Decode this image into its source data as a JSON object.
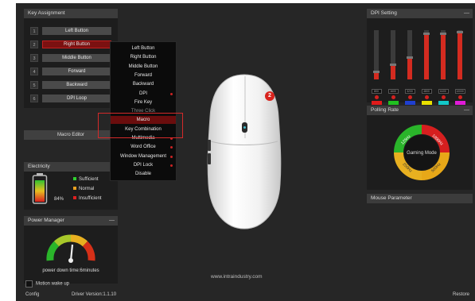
{
  "key_assignment": {
    "title": "Key Assignment",
    "rows": [
      {
        "num": "1",
        "label": "Left Button",
        "selected": false
      },
      {
        "num": "2",
        "label": "Right Button",
        "selected": true
      },
      {
        "num": "3",
        "label": "Middle Button",
        "selected": false
      },
      {
        "num": "4",
        "label": "Forward",
        "selected": false
      },
      {
        "num": "5",
        "label": "Backward",
        "selected": false
      },
      {
        "num": "6",
        "label": "DPI Loop",
        "selected": false
      }
    ],
    "macro_editor": "Macro Editor"
  },
  "context_menu": {
    "items": [
      {
        "label": "Left Button",
        "submenu": false
      },
      {
        "label": "Right Button",
        "submenu": false
      },
      {
        "label": "Middle Button",
        "submenu": false
      },
      {
        "label": "Forward",
        "submenu": false
      },
      {
        "label": "Backward",
        "submenu": false
      },
      {
        "label": "DPI",
        "submenu": true
      },
      {
        "label": "Fire Key",
        "submenu": false
      },
      {
        "label": "Three Click",
        "submenu": false,
        "dim": true
      },
      {
        "label": "Macro",
        "submenu": false,
        "highlight": true
      },
      {
        "label": "Key Combination",
        "submenu": false
      },
      {
        "label": "Multimedia",
        "submenu": true
      },
      {
        "label": "Word Office",
        "submenu": true
      },
      {
        "label": "Window Management",
        "submenu": true
      },
      {
        "label": "DPI Lock",
        "submenu": true
      },
      {
        "label": "Disable",
        "submenu": false
      }
    ]
  },
  "electricity": {
    "title": "Electricity",
    "percent_text": "84%",
    "level": 0.84,
    "legend": [
      {
        "label": "Sufficient",
        "color": "#2fd12f"
      },
      {
        "label": "Normal",
        "color": "#e8a020"
      },
      {
        "label": "Insufficient",
        "color": "#e02020"
      }
    ]
  },
  "power_manager": {
    "title": "Power Manager",
    "dash": "—",
    "power_down": "power down time:6minutes",
    "motion_wake": "Motion wake up"
  },
  "bottom": {
    "config": "Config",
    "driver": "Driver Version:1.1.10",
    "restore": "Restore"
  },
  "mouse": {
    "badge": "2",
    "website": "www.intraindustry.com"
  },
  "dpi_setting": {
    "title": "DPI Setting",
    "dash": "—",
    "levels": [
      {
        "value": "800",
        "fill": 0.15,
        "color": "#e01b1b"
      },
      {
        "value": "1600",
        "fill": 0.3,
        "color": "#20c020"
      },
      {
        "value": "3200",
        "fill": 0.45,
        "color": "#1f3fd0"
      },
      {
        "value": "4800",
        "fill": 0.92,
        "color": "#e8e000"
      },
      {
        "value": "6400",
        "fill": 0.92,
        "color": "#12c8c8"
      },
      {
        "value": "10000",
        "fill": 0.96,
        "color": "#e01bd8"
      }
    ]
  },
  "polling_rate": {
    "title": "Polling Rate",
    "dash": "—",
    "center": "Gaming Mode",
    "segments": [
      "125Hz",
      "250Hz",
      "500Hz",
      "1000Hz"
    ]
  },
  "mouse_parameter": {
    "title": "Mouse Parameter"
  },
  "colors": {
    "accent": "#c81e1e",
    "panel_bg": "#1d1d1d",
    "app_bg": "#262626"
  }
}
